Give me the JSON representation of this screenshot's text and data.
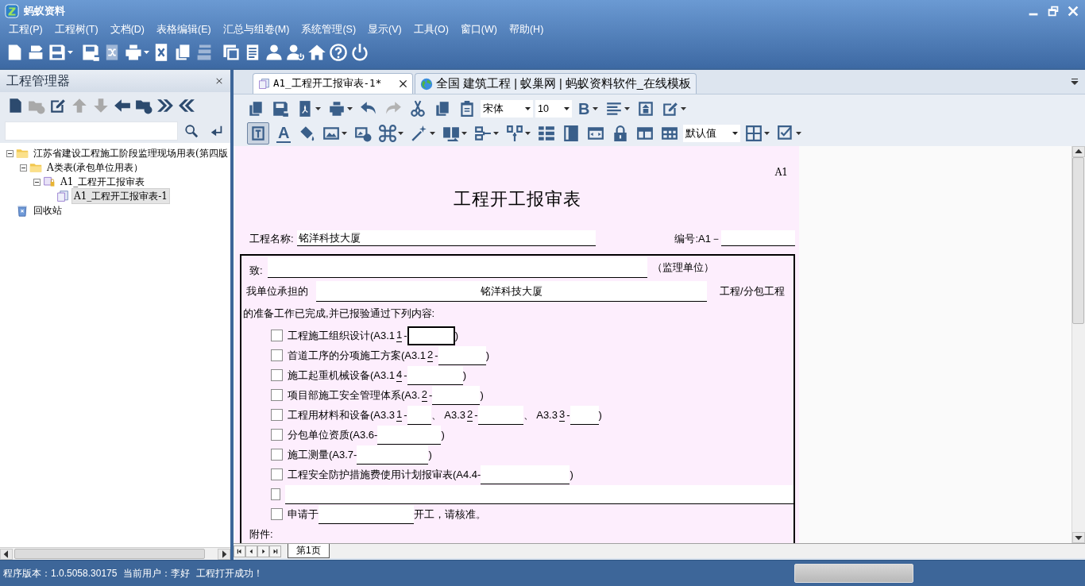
{
  "window": {
    "title": "蚂蚁资料"
  },
  "menu": [
    "工程(P)",
    "工程树(T)",
    "文档(D)",
    "表格编辑(E)",
    "汇总与组卷(M)",
    "系统管理(S)",
    "显示(V)",
    "工具(O)",
    "窗口(W)",
    "帮助(H)"
  ],
  "toolbar": [
    {
      "kind": "new",
      "dropdown": false,
      "disabled": false
    },
    {
      "kind": "export",
      "dropdown": false,
      "disabled": false
    },
    {
      "kind": "save",
      "dropdown": true,
      "disabled": false
    },
    {
      "kind": "saveas",
      "dropdown": false,
      "disabled": false
    },
    {
      "kind": "shuffle",
      "dropdown": false,
      "disabled": true
    },
    {
      "kind": "print",
      "dropdown": true,
      "disabled": false
    },
    {
      "kind": "deldoc",
      "dropdown": false,
      "disabled": false
    },
    {
      "kind": "copy",
      "dropdown": false,
      "disabled": false
    },
    {
      "kind": "stack",
      "dropdown": false,
      "disabled": true
    },
    {
      "kind": "window",
      "dropdown": false,
      "disabled": false
    },
    {
      "kind": "listdoc",
      "dropdown": false,
      "disabled": false
    },
    {
      "kind": "user",
      "dropdown": false,
      "disabled": false
    },
    {
      "kind": "userpower",
      "dropdown": false,
      "disabled": false
    },
    {
      "kind": "home",
      "dropdown": false,
      "disabled": false
    },
    {
      "kind": "help",
      "dropdown": false,
      "disabled": false
    },
    {
      "kind": "power",
      "dropdown": false,
      "disabled": false
    }
  ],
  "project_panel": {
    "title": "工程管理器",
    "toolbar": [
      {
        "kind": "new",
        "disabled": false
      },
      {
        "kind": "addfolder",
        "disabled": true
      },
      {
        "kind": "edit",
        "disabled": false
      },
      {
        "kind": "up",
        "disabled": true
      },
      {
        "kind": "down",
        "disabled": true
      },
      {
        "kind": "left",
        "disabled": false
      },
      {
        "kind": "rmfolder",
        "disabled": false
      },
      {
        "kind": "dright",
        "disabled": false
      },
      {
        "kind": "dleft",
        "disabled": false
      }
    ],
    "tree": [
      {
        "label": "江苏省建设工程施工阶段监理现场用表(第四版",
        "kind": "folder",
        "expanded": true,
        "selected": false,
        "children": [
          {
            "label": "A类表(承包单位用表）",
            "kind": "folder",
            "expanded": true,
            "selected": false,
            "children": [
              {
                "label": "A1_工程开工报审表",
                "kind": "formgroup",
                "expanded": true,
                "selected": false,
                "children": [
                  {
                    "label": "A1_工程开工报审表-1",
                    "kind": "form",
                    "selected": true
                  }
                ]
              }
            ]
          }
        ]
      },
      {
        "label": "回收站",
        "kind": "recycle",
        "selected": false
      }
    ]
  },
  "tabs": [
    {
      "label": "A1_工程开工报审表-1*",
      "kind": "form",
      "selected": true,
      "closable": true
    },
    {
      "label": "全国 建筑工程 | 蚁巢网 | 蚂蚁资料软件_在线模板",
      "kind": "web",
      "selected": false,
      "closable": false
    }
  ],
  "editor_toolbar": [
    [
      {
        "kind": "copy",
        "dropdown": false,
        "disabled": false,
        "pressed": false
      },
      {
        "kind": "saveas",
        "dropdown": false,
        "disabled": false,
        "pressed": false
      },
      {
        "kind": "pdf",
        "dropdown": true,
        "disabled": false,
        "pressed": false
      },
      {
        "kind": "print",
        "dropdown": true,
        "disabled": false,
        "pressed": false
      },
      {
        "kind": "undo",
        "dropdown": false,
        "disabled": false,
        "pressed": false
      },
      {
        "kind": "redo",
        "dropdown": false,
        "disabled": true,
        "pressed": false
      },
      {
        "kind": "cut",
        "dropdown": false,
        "disabled": false,
        "pressed": false
      },
      {
        "kind": "copy",
        "dropdown": false,
        "disabled": false,
        "pressed": false
      },
      {
        "kind": "paste",
        "dropdown": false,
        "disabled": false,
        "pressed": false
      },
      {
        "kind": "select",
        "value": "宋体"
      },
      {
        "kind": "select",
        "value": "10"
      },
      {
        "kind": "glyph",
        "text": "B",
        "dropdown": true,
        "disabled": false,
        "pressed": false
      },
      {
        "kind": "align",
        "dropdown": true,
        "disabled": false,
        "pressed": false
      },
      {
        "kind": "stamp",
        "dropdown": false,
        "disabled": false,
        "pressed": false
      },
      {
        "kind": "edit",
        "dropdown": true,
        "disabled": false,
        "pressed": false
      }
    ],
    [
      {
        "kind": "format",
        "dropdown": false,
        "disabled": false,
        "pressed": true
      },
      {
        "kind": "glyph",
        "text": "A",
        "dropdown": false,
        "disabled": false,
        "pressed": false
      },
      {
        "kind": "fill",
        "dropdown": false,
        "disabled": false,
        "pressed": false
      },
      {
        "kind": "image",
        "dropdown": true,
        "disabled": false,
        "pressed": false
      },
      {
        "kind": "delimage",
        "dropdown": false,
        "disabled": false,
        "pressed": false
      },
      {
        "kind": "command",
        "dropdown": true,
        "disabled": false,
        "pressed": false
      },
      {
        "kind": "wand",
        "dropdown": true,
        "disabled": false,
        "pressed": false
      },
      {
        "kind": "merge",
        "dropdown": true,
        "disabled": false,
        "pressed": false
      },
      {
        "kind": "hsplit",
        "dropdown": true,
        "disabled": false,
        "pressed": false
      },
      {
        "kind": "vsplit",
        "dropdown": true,
        "disabled": false,
        "pressed": false
      },
      {
        "kind": "columns",
        "dropdown": false,
        "disabled": false,
        "pressed": false
      },
      {
        "kind": "rowheight",
        "dropdown": false,
        "disabled": false,
        "pressed": false
      },
      {
        "kind": "colwidth",
        "dropdown": false,
        "disabled": false,
        "pressed": false
      },
      {
        "kind": "lock",
        "dropdown": false,
        "disabled": false,
        "pressed": false
      },
      {
        "kind": "table",
        "dropdown": false,
        "disabled": false,
        "pressed": false
      },
      {
        "kind": "grid",
        "dropdown": false,
        "disabled": false,
        "pressed": false
      },
      {
        "kind": "select",
        "value": "默认值"
      },
      {
        "kind": "borders",
        "dropdown": true,
        "disabled": false,
        "pressed": false
      },
      {
        "kind": "check",
        "dropdown": true,
        "disabled": false,
        "pressed": false
      }
    ]
  ],
  "form": {
    "code": "A1",
    "title": "工程开工报审表",
    "name_label": "工程名称:",
    "name_value": "铭洋科技大厦",
    "number_label": "编号:A1－",
    "to_label": "致:",
    "to_suffix": "（监理单位）",
    "unit_label": "我单位承担的",
    "unit_value": "铭洋科技大厦",
    "unit_suffix": "工程/分包工程",
    "intro": "的准备工作已完成,并已报验通过下列内容:",
    "items": [
      {
        "checked": false,
        "parts": [
          {
            "kind": "text",
            "text": "工程施工组织设计(A3.1 "
          },
          {
            "kind": "mark",
            "text": "1"
          },
          {
            "kind": "text",
            "text": "-"
          },
          {
            "kind": "blank",
            "focused": true
          },
          {
            "kind": "text",
            "text": ")"
          }
        ]
      },
      {
        "checked": false,
        "parts": [
          {
            "kind": "text",
            "text": "首道工序的分项施工方案(A3.1"
          },
          {
            "kind": "mark",
            "text": "2"
          },
          {
            "kind": "text",
            "text": "-"
          },
          {
            "kind": "blank",
            "focused": false
          },
          {
            "kind": "text",
            "text": ")"
          }
        ]
      },
      {
        "checked": false,
        "parts": [
          {
            "kind": "text",
            "text": "施工起重机械设备(A3.1 "
          },
          {
            "kind": "mark",
            "text": "4"
          },
          {
            "kind": "text",
            "text": "-"
          },
          {
            "kind": "blank",
            "focused": false
          },
          {
            "kind": "text",
            "text": ")"
          }
        ]
      },
      {
        "checked": false,
        "parts": [
          {
            "kind": "text",
            "text": "项目部施工安全管理体系(A3. "
          },
          {
            "kind": "mark",
            "text": "2"
          },
          {
            "kind": "text",
            "text": "-"
          },
          {
            "kind": "blank",
            "focused": false
          },
          {
            "kind": "text",
            "text": ")"
          }
        ]
      },
      {
        "checked": false,
        "parts": [
          {
            "kind": "text",
            "text": "工程用材料和设备(A3.3 "
          },
          {
            "kind": "mark",
            "text": "1"
          },
          {
            "kind": "text",
            "text": "-"
          },
          {
            "kind": "blank",
            "focused": false
          },
          {
            "kind": "text",
            "text": "、 A3.3"
          },
          {
            "kind": "mark",
            "text": "2"
          },
          {
            "kind": "text",
            "text": "-"
          },
          {
            "kind": "blank",
            "focused": false
          },
          {
            "kind": "text",
            "text": "、 A3.3 "
          },
          {
            "kind": "mark",
            "text": "3"
          },
          {
            "kind": "text",
            "text": "-"
          },
          {
            "kind": "blank",
            "focused": false
          },
          {
            "kind": "text",
            "text": ")"
          }
        ]
      },
      {
        "checked": false,
        "parts": [
          {
            "kind": "text",
            "text": "分包单位资质(A3.6-"
          },
          {
            "kind": "blank",
            "focused": false
          },
          {
            "kind": "text",
            "text": ")"
          }
        ]
      },
      {
        "checked": false,
        "parts": [
          {
            "kind": "text",
            "text": "施工测量(A3.7-"
          },
          {
            "kind": "blank",
            "focused": false
          },
          {
            "kind": "text",
            "text": ")"
          }
        ]
      },
      {
        "checked": false,
        "parts": [
          {
            "kind": "text",
            "text": "工程安全防护措施费使用计划报审表(A4.4-"
          },
          {
            "kind": "blank",
            "focused": false
          },
          {
            "kind": "text",
            "text": ")"
          }
        ]
      },
      {
        "checked": false,
        "parts": [
          {
            "kind": "blank",
            "focused": false
          }
        ]
      },
      {
        "checked": false,
        "parts": [
          {
            "kind": "text",
            "text": "申请于"
          },
          {
            "kind": "blank",
            "focused": false
          },
          {
            "kind": "text",
            "text": "开工，请核准。"
          }
        ]
      }
    ],
    "attachments_label": "附件:"
  },
  "sheet_tabs": [
    {
      "label": "第1页",
      "selected": true
    }
  ],
  "status_bar": {
    "version": "程序版本：1.0.5058.30175",
    "user": "当前用户：李好",
    "message": "工程打开成功！"
  }
}
